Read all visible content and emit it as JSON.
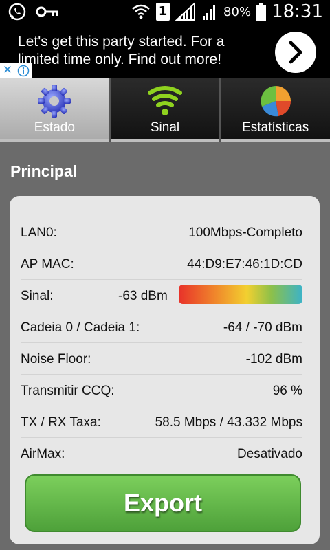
{
  "status_bar": {
    "battery_percent": "80%",
    "time": "18:31",
    "sim_slot": "1",
    "icons": [
      "whatsapp-icon",
      "key-icon",
      "wifi-icon",
      "sim-icon",
      "signal-icon",
      "battery-icon"
    ]
  },
  "ad": {
    "text": "Let's get this party started. For a limited time only. Find out more!",
    "button_icon": "chevron-right-icon",
    "close_glyph": "✕",
    "info_icon": "info-icon"
  },
  "tabs": [
    {
      "label": "Estado",
      "icon": "gear-icon",
      "active": true
    },
    {
      "label": "Sinal",
      "icon": "wifi-signal-icon",
      "active": false
    },
    {
      "label": "Estatísticas",
      "icon": "pie-chart-icon",
      "active": false
    }
  ],
  "section": {
    "title": "Principal"
  },
  "rows": [
    {
      "label": "LAN0:",
      "value": "100Mbps-Completo"
    },
    {
      "label": "AP MAC:",
      "value": "44:D9:E7:46:1D:CD"
    },
    {
      "label": "Sinal:",
      "value": "-63 dBm"
    },
    {
      "label": "Cadeia 0 / Cadeia 1:",
      "value": "-64 / -70 dBm"
    },
    {
      "label": "Noise Floor:",
      "value": "-102 dBm"
    },
    {
      "label": "Transmitir CCQ:",
      "value": "96 %"
    },
    {
      "label": "TX / RX Taxa:",
      "value": "58.5 Mbps / 43.332 Mbps"
    },
    {
      "label": "AirMax:",
      "value": "Desativado"
    }
  ],
  "export_button": {
    "label": "Export"
  },
  "colors": {
    "accent_green": "#5cb845",
    "card_bg": "#e7e7e7",
    "page_bg": "#6b6b6b"
  }
}
